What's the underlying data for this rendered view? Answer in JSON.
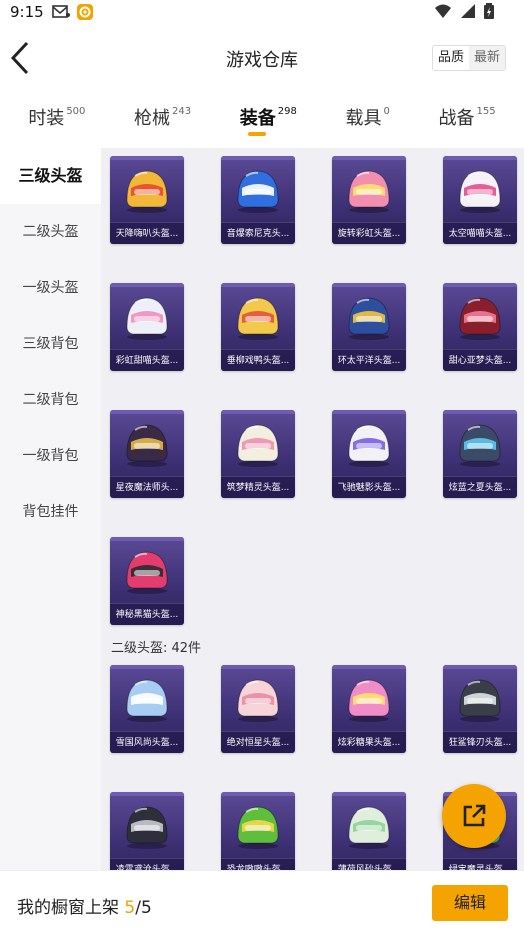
{
  "status_bar": {
    "time": "9:15"
  },
  "header": {
    "title": "游戏仓库",
    "sort_quality": "品质",
    "sort_latest": "最新"
  },
  "tabs": [
    {
      "label": "时装",
      "count": "500"
    },
    {
      "label": "枪械",
      "count": "243"
    },
    {
      "label": "装备",
      "count": "298"
    },
    {
      "label": "载具",
      "count": "0"
    },
    {
      "label": "战备",
      "count": "155"
    }
  ],
  "active_tab": 2,
  "sidebar": {
    "items": [
      "三级头盔",
      "二级头盔",
      "一级头盔",
      "三级背包",
      "二级背包",
      "一级背包",
      "背包挂件"
    ],
    "active": 0
  },
  "section1_items": [
    {
      "name": "天降嗨叭头盔...",
      "color": "#f3b83a",
      "accent": "#e64a2e"
    },
    {
      "name": "音爆索尼克头...",
      "color": "#2f6fe0",
      "accent": "#ffffff"
    },
    {
      "name": "旋转彩虹头盔...",
      "color": "#f28fb0",
      "accent": "#ffe36b"
    },
    {
      "name": "太空喵喵头盔...",
      "color": "#f5f3f7",
      "accent": "#e44c8a"
    },
    {
      "name": "彩虹甜喵头盔...",
      "color": "#eef0f8",
      "accent": "#f08fc0"
    },
    {
      "name": "垂柳戏鸭头盔...",
      "color": "#f2c94c",
      "accent": "#e4533a"
    },
    {
      "name": "环太平洋头盔...",
      "color": "#2d4f9e",
      "accent": "#f3c340"
    },
    {
      "name": "甜心亚梦头盔...",
      "color": "#8a1f2c",
      "accent": "#f27a9a"
    },
    {
      "name": "星夜魔法师头...",
      "color": "#3a2a45",
      "accent": "#e5b84a"
    },
    {
      "name": "筑梦精灵头盔...",
      "color": "#f3eee0",
      "accent": "#f08fb0"
    },
    {
      "name": "飞驰魅影头盔...",
      "color": "#f2f2f6",
      "accent": "#7a5ee0"
    },
    {
      "name": "炫蓝之夏头盔...",
      "color": "#3b4a66",
      "accent": "#5bc8f0"
    },
    {
      "name": "神秘黑猫头盔...",
      "color": "#e23d6e",
      "accent": "#2b2b33"
    }
  ],
  "section2_header": "二级头盔: 42件",
  "section2_items": [
    {
      "name": "雪国风尚头盔...",
      "color": "#a8cdf2",
      "accent": "#ffffff"
    },
    {
      "name": "绝对恒星头盔...",
      "color": "#f7d4d8",
      "accent": "#e98aa4"
    },
    {
      "name": "炫彩糖果头盔...",
      "color": "#f08cc8",
      "accent": "#ffe26b"
    },
    {
      "name": "狂鲨锋刃头盔...",
      "color": "#3a3e4a",
      "accent": "#dfe3ea"
    },
    {
      "name": "凌霄鸢沧头盔...",
      "color": "#2f2f3c",
      "accent": "#c9c9d2"
    },
    {
      "name": "恐龙嗷嗷头盔...",
      "color": "#5fbf3d",
      "accent": "#f3d84a"
    },
    {
      "name": "薄荷风砂头盔...",
      "color": "#dfeedd",
      "accent": "#8fd19a"
    },
    {
      "name": "绿宝魔灵头盔...",
      "color": "#4ab07a",
      "accent": "#2b2b33"
    }
  ],
  "bottom_bar": {
    "label": "我的橱窗上架",
    "current": "5",
    "separator": "/",
    "total": "5",
    "edit_label": "编辑"
  },
  "colors": {
    "accent": "#f5a300",
    "card_bg": "#3c2f72"
  }
}
